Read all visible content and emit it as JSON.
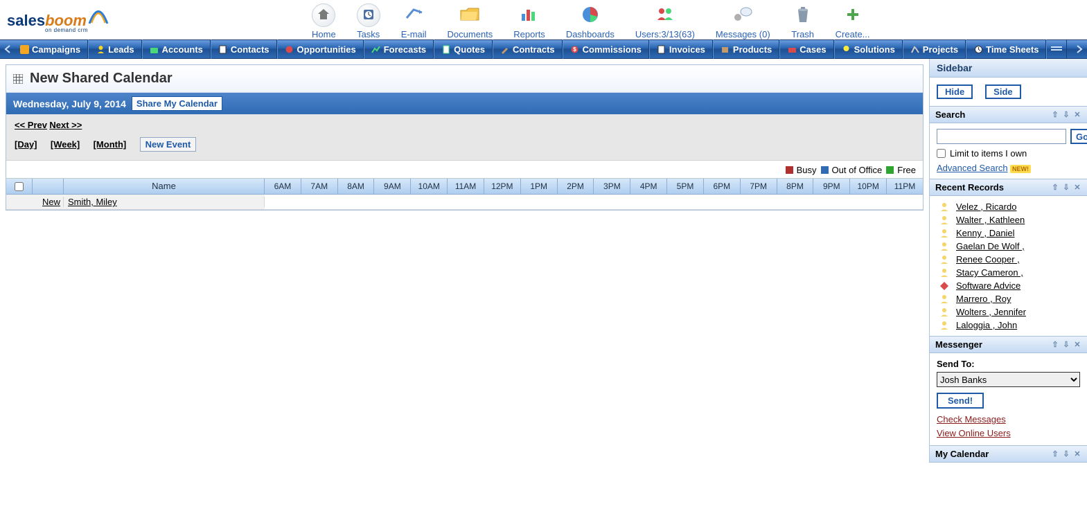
{
  "logo": {
    "part1": "sales",
    "part2": "boom",
    "tagline": "on demand crm"
  },
  "topnav": {
    "home": "Home",
    "tasks": "Tasks",
    "email": "E-mail",
    "documents": "Documents",
    "reports": "Reports",
    "dashboards": "Dashboards",
    "users": "Users:3/13(63)",
    "messages": "Messages (0)",
    "trash": "Trash",
    "create": "Create..."
  },
  "navbar": [
    "Campaigns",
    "Leads",
    "Accounts",
    "Contacts",
    "Opportunities",
    "Forecasts",
    "Quotes",
    "Contracts",
    "Commissions",
    "Invoices",
    "Products",
    "Cases",
    "Solutions",
    "Projects",
    "Time Sheets"
  ],
  "page": {
    "title": "New Shared Calendar",
    "date": "Wednesday, July 9, 2014",
    "share_btn": "Share My Calendar",
    "prev": "<< Prev",
    "next": "Next >>",
    "views": {
      "day": "[Day]",
      "week": "[Week]",
      "month": "[Month]"
    },
    "new_event": "New Event"
  },
  "legend": {
    "busy": "Busy",
    "out": "Out of Office",
    "free": "Free",
    "busy_color": "#b03030",
    "out_color": "#2f6cb3",
    "free_color": "#2fa52f"
  },
  "grid": {
    "name_header": "Name",
    "hours": [
      "6AM",
      "7AM",
      "8AM",
      "9AM",
      "10AM",
      "11AM",
      "12PM",
      "1PM",
      "2PM",
      "3PM",
      "4PM",
      "5PM",
      "6PM",
      "7PM",
      "8PM",
      "9PM",
      "10PM",
      "11PM"
    ],
    "rows": [
      {
        "action": "New",
        "name": "Smith, Miley"
      }
    ]
  },
  "sidebar": {
    "title": "Sidebar",
    "hide": "Hide",
    "side": "Side",
    "search": {
      "title": "Search",
      "go": "Go",
      "limit": "Limit to items I own",
      "advanced": "Advanced Search",
      "new_badge": "NEW!"
    },
    "recent": {
      "title": "Recent Records",
      "items": [
        "Velez , Ricardo",
        "Walter , Kathleen",
        "Kenny , Daniel",
        "Gaelan De Wolf ,",
        "Renee Cooper ,",
        "Stacy Cameron ,",
        "Software Advice",
        "Marrero , Roy",
        "Wolters , Jennifer",
        "Laloggia , John"
      ]
    },
    "messenger": {
      "title": "Messenger",
      "send_to": "Send To:",
      "selected": "Josh Banks",
      "send": "Send!",
      "check": "Check Messages",
      "view_online": "View Online Users"
    },
    "mycal": {
      "title": "My Calendar"
    }
  }
}
